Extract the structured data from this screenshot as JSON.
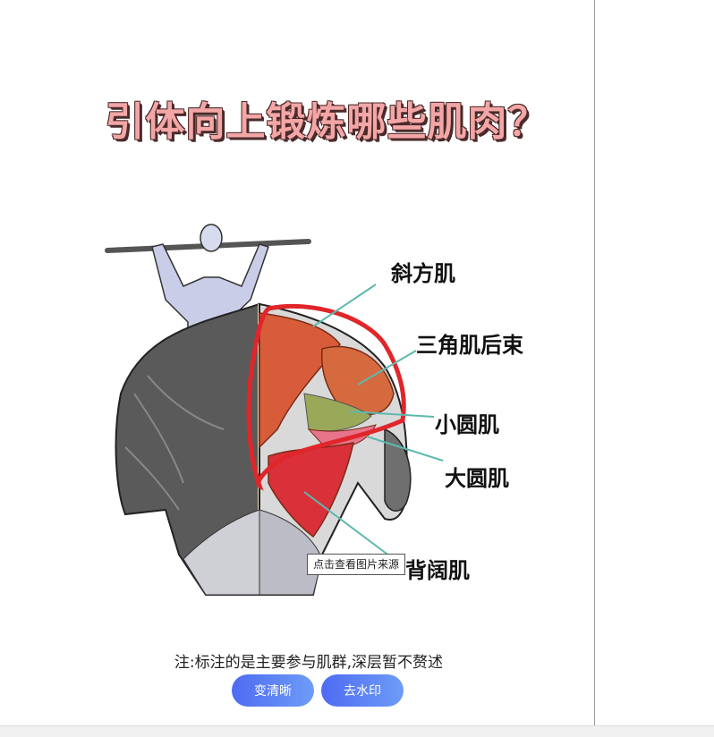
{
  "poster": {
    "title": "引体向上锻炼哪些肌肉？"
  },
  "labels": {
    "trapezius": "斜方肌",
    "rear_deltoid": "三角肌后束",
    "teres_minor": "小圆肌",
    "teres_major": "大圆肌",
    "latissimus": "背阔肌"
  },
  "tooltip": {
    "source": "点击查看图片来源"
  },
  "note": "注:标注的是主要参与肌群,深层暂不赘述",
  "buttons": {
    "clear": "变清晰",
    "watermark": "去水印"
  },
  "colors": {
    "title_pink": "#f4a6a6",
    "button_start": "#4e6bf3",
    "button_end": "#6e9cf7",
    "annotation_red": "#e0262a",
    "leader_teal": "#5cb9ad"
  }
}
